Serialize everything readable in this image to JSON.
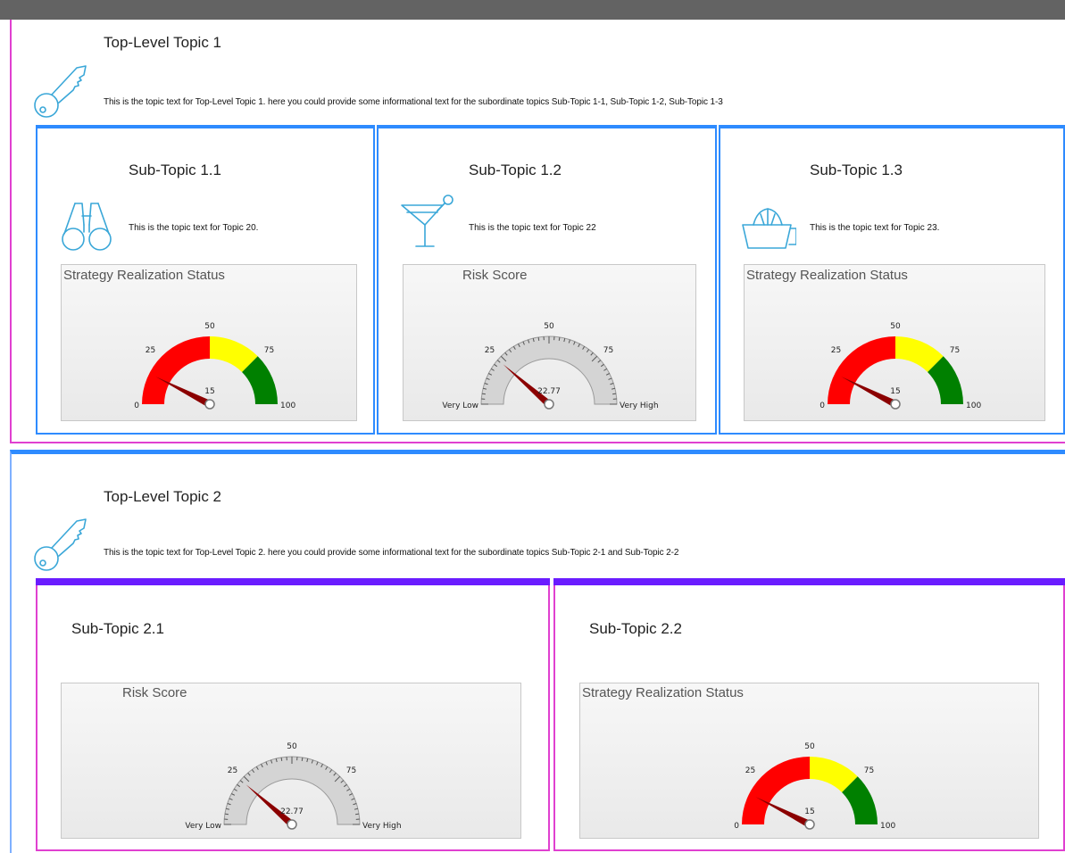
{
  "topics": [
    {
      "title": "Top-Level Topic 1",
      "text": "This is the topic text for Top-Level Topic 1. here you could provide some informational text for the subordinate topics Sub-Topic 1-1, Sub-Topic 1-2, Sub-Topic 1-3",
      "icon": "key-icon",
      "subtopics": [
        {
          "title": "Sub-Topic 1.1",
          "icon": "binoculars-icon",
          "text": "This is the topic text for Topic 20.",
          "gauge": {
            "title": "Strategy Realization Status",
            "type": "colored",
            "ticks": [
              "0",
              "25",
              "50",
              "75",
              "100"
            ],
            "value": 15,
            "value_label": "15"
          }
        },
        {
          "title": "Sub-Topic 1.2",
          "icon": "cocktail-glass-icon",
          "text": "This is the topic text for Topic 22",
          "gauge": {
            "title": "Risk Score",
            "type": "grey",
            "ticks": [
              "Very Low",
              "25",
              "50",
              "75",
              "Very High"
            ],
            "value": 22.77,
            "value_label": "22.77"
          }
        },
        {
          "title": "Sub-Topic 1.3",
          "icon": "juicer-icon",
          "text": "This is the topic text for Topic 23.",
          "gauge": {
            "title": "Strategy Realization Status",
            "type": "colored",
            "ticks": [
              "0",
              "25",
              "50",
              "75",
              "100"
            ],
            "value": 15,
            "value_label": "15"
          }
        }
      ]
    },
    {
      "title": "Top-Level Topic 2",
      "text": "This is the topic text for Top-Level Topic 2. here you could provide some informational text for the subordinate topics Sub-Topic 2-1 and Sub-Topic 2-2",
      "icon": "key-icon",
      "subtopics": [
        {
          "title": "Sub-Topic 2.1",
          "gauge": {
            "title": "Risk Score",
            "type": "grey",
            "ticks": [
              "Very Low",
              "25",
              "50",
              "75",
              "Very High"
            ],
            "value": 22.77,
            "value_label": "22.77"
          }
        },
        {
          "title": "Sub-Topic 2.2",
          "gauge": {
            "title": "Strategy Realization Status",
            "type": "colored",
            "ticks": [
              "0",
              "25",
              "50",
              "75",
              "100"
            ],
            "value": 15,
            "value_label": "15"
          }
        }
      ]
    }
  ],
  "colors": {
    "blue_border": "#2e8bff",
    "pink_border": "#e040d0",
    "purple_bar": "#6a1cff",
    "icon": "#3aa7d8",
    "gauge_red": "#ff0000",
    "gauge_yellow": "#ffff00",
    "gauge_green": "#008000",
    "needle": "#8b0000",
    "grey_arc": "#d4d4d4"
  }
}
